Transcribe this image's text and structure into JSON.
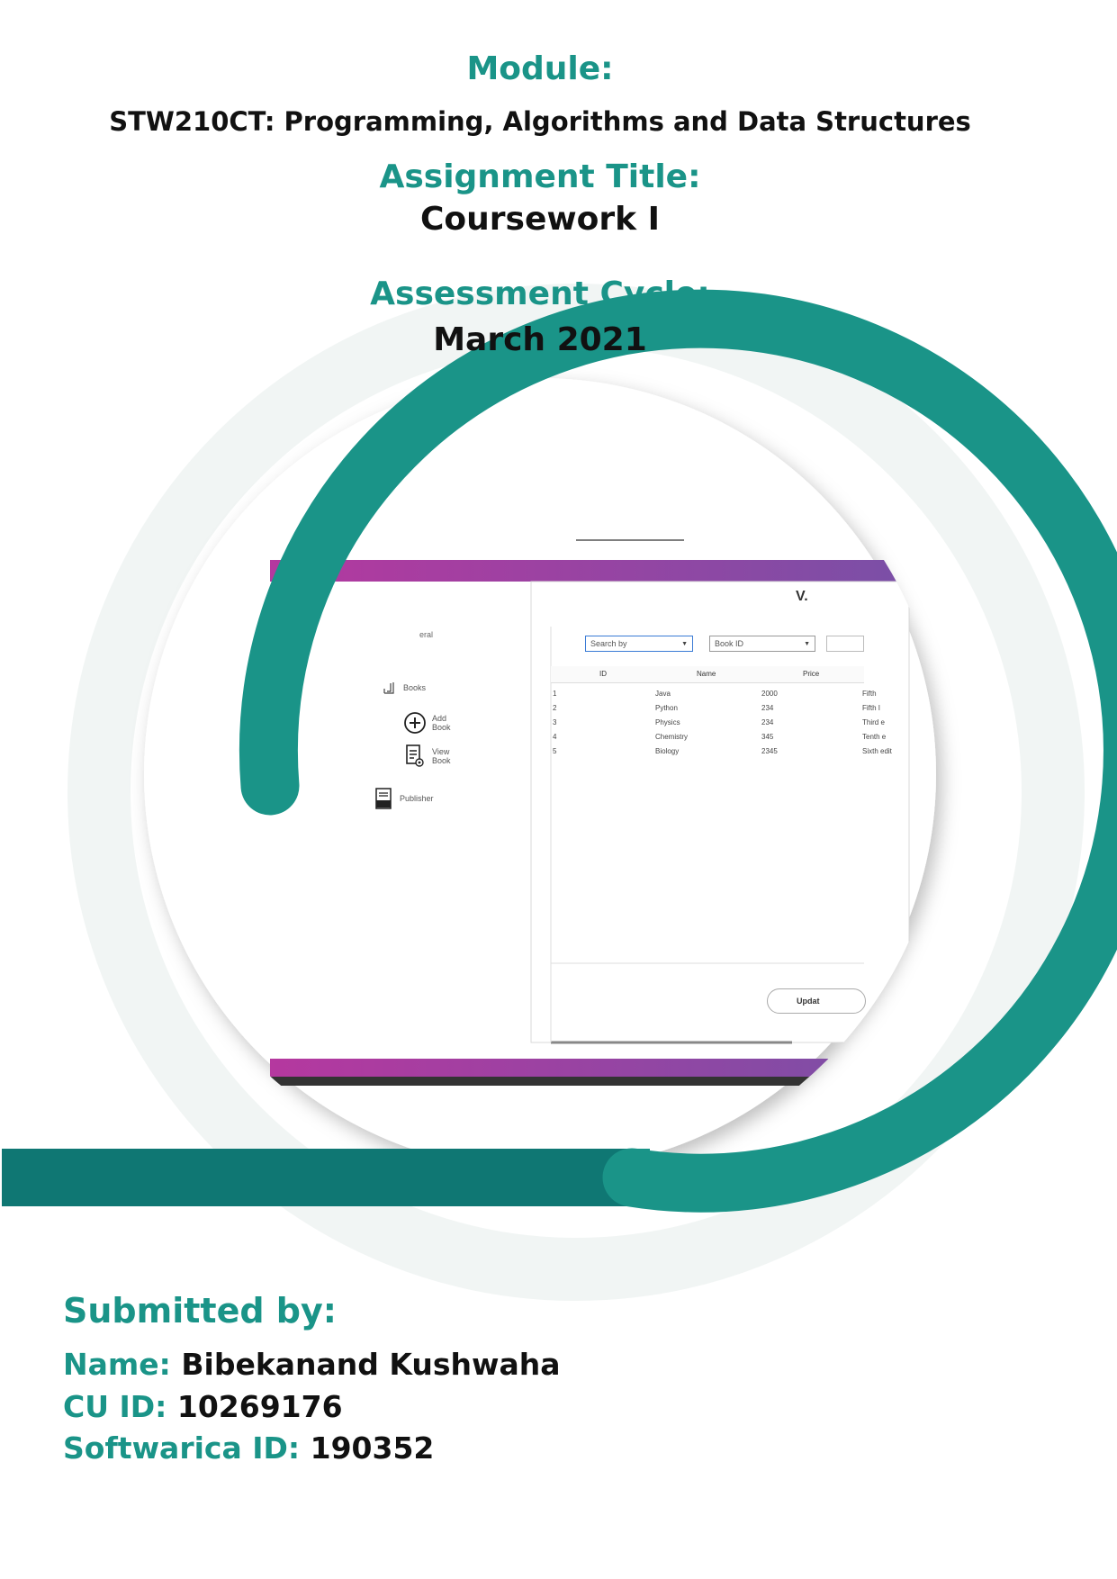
{
  "header": {
    "module_label": "Module:",
    "module_value": "STW210CT: Programming, Algorithms and Data Structures",
    "assignment_label": "Assignment Title:",
    "assignment_value": "Coursework I",
    "cycle_label": "Assessment Cycle:",
    "cycle_value": "March 2021"
  },
  "screenshot": {
    "sidebar_heading": "eral",
    "nav": {
      "books": "Books",
      "add_book": "Add Book",
      "view_book": "View Book",
      "publisher": "Publisher"
    },
    "window_title_fragment": "V.",
    "search_by_placeholder": "Search by",
    "search_field_value": "Book ID",
    "table": {
      "columns": [
        "ID",
        "Name",
        "Price"
      ],
      "rows": [
        {
          "id": "1",
          "name": "Java",
          "price": "2000",
          "extra": "Fifth"
        },
        {
          "id": "2",
          "name": "Python",
          "price": "234",
          "extra": "Fifth I"
        },
        {
          "id": "3",
          "name": "Physics",
          "price": "234",
          "extra": "Third e"
        },
        {
          "id": "4",
          "name": "Chemistry",
          "price": "345",
          "extra": "Tenth e"
        },
        {
          "id": "5",
          "name": "Biology",
          "price": "2345",
          "extra": "Sixth edit"
        }
      ]
    },
    "update_button": "Updat"
  },
  "submitted": {
    "heading": "Submitted by:",
    "name_label": "Name:",
    "name_value": "Bibekanand Kushwaha",
    "cuid_label": "CU ID:",
    "cuid_value": "10269176",
    "softwarica_label": "Softwarica ID:",
    "softwarica_value": "190352"
  },
  "colors": {
    "teal": "#1a9488",
    "dark_teal": "#0f7773",
    "purple": "#a0459f"
  }
}
